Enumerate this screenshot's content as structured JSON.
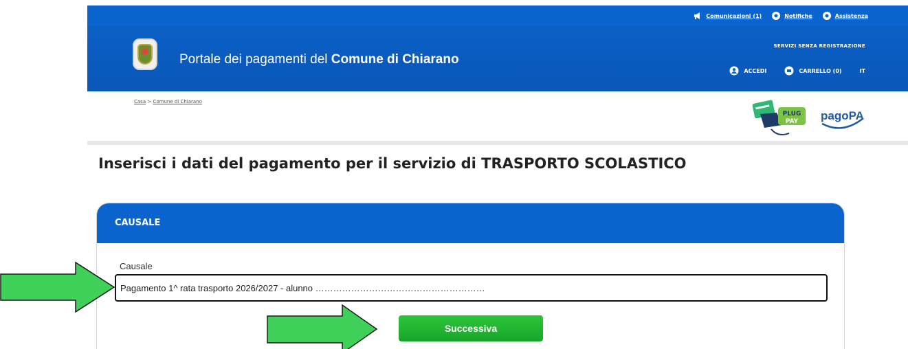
{
  "topbar": {
    "links": [
      {
        "label": "Comunicazioni (1)",
        "icon": "megaphone-icon"
      },
      {
        "label": "Notifiche",
        "icon": "bell-icon"
      },
      {
        "label": "Assistenza",
        "icon": "help-icon"
      }
    ]
  },
  "header": {
    "title_prefix": "Portale dei pagamenti del ",
    "title_bold": "Comune di Chiarano",
    "no_registration": "SERVIZI SENZA REGISTRAZIONE",
    "login": "ACCEDI",
    "cart": "CARRELLO (0)",
    "language": "IT"
  },
  "breadcrumb": {
    "home": "Casa",
    "separator": " > ",
    "current": "Comune di Chiarano"
  },
  "logos": {
    "plugpay_top": "PLUG",
    "plugpay_bottom": "PAY",
    "pagopa": "pagoPA"
  },
  "page_title": "Inserisci i dati del pagamento per il servizio di TRASPORTO SCOLASTICO",
  "card": {
    "header": "CAUSALE",
    "field_label": "Causale",
    "field_value": "Pagamento 1^ rata trasporto 2026/2027 - alunno  …………………………………………………",
    "next_button": "Successiva"
  },
  "colors": {
    "brand_blue": "#0b63ce",
    "button_green": "#1fb431",
    "arrow_green": "#3fd05a"
  }
}
